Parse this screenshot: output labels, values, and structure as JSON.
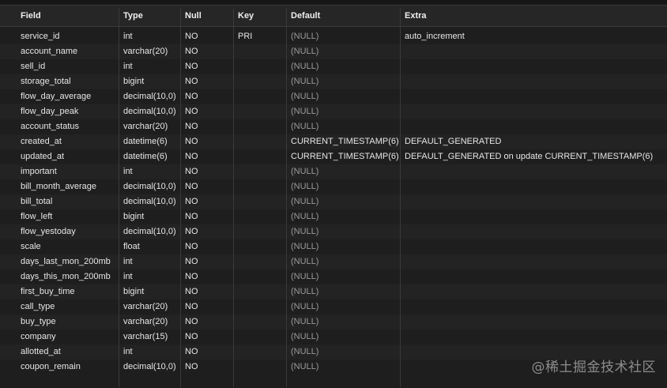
{
  "columns": [
    "Field",
    "Type",
    "Null",
    "Key",
    "Default",
    "Extra"
  ],
  "rows": [
    [
      "service_id",
      "int",
      "NO",
      "PRI",
      "(NULL)",
      "auto_increment"
    ],
    [
      "account_name",
      "varchar(20)",
      "NO",
      "",
      "(NULL)",
      ""
    ],
    [
      "sell_id",
      "int",
      "NO",
      "",
      "(NULL)",
      ""
    ],
    [
      "storage_total",
      "bigint",
      "NO",
      "",
      "(NULL)",
      ""
    ],
    [
      "flow_day_average",
      "decimal(10,0)",
      "NO",
      "",
      "(NULL)",
      ""
    ],
    [
      "flow_day_peak",
      "decimal(10,0)",
      "NO",
      "",
      "(NULL)",
      ""
    ],
    [
      "account_status",
      "varchar(20)",
      "NO",
      "",
      "(NULL)",
      ""
    ],
    [
      "created_at",
      "datetime(6)",
      "NO",
      "",
      "CURRENT_TIMESTAMP(6)",
      "DEFAULT_GENERATED"
    ],
    [
      "updated_at",
      "datetime(6)",
      "NO",
      "",
      "CURRENT_TIMESTAMP(6)",
      "DEFAULT_GENERATED on update CURRENT_TIMESTAMP(6)"
    ],
    [
      "important",
      "int",
      "NO",
      "",
      "(NULL)",
      ""
    ],
    [
      "bill_month_average",
      "decimal(10,0)",
      "NO",
      "",
      "(NULL)",
      ""
    ],
    [
      "bill_total",
      "decimal(10,0)",
      "NO",
      "",
      "(NULL)",
      ""
    ],
    [
      "flow_left",
      "bigint",
      "NO",
      "",
      "(NULL)",
      ""
    ],
    [
      "flow_yestoday",
      "decimal(10,0)",
      "NO",
      "",
      "(NULL)",
      ""
    ],
    [
      "scale",
      "float",
      "NO",
      "",
      "(NULL)",
      ""
    ],
    [
      "days_last_mon_200mb",
      "int",
      "NO",
      "",
      "(NULL)",
      ""
    ],
    [
      "days_this_mon_200mb",
      "int",
      "NO",
      "",
      "(NULL)",
      ""
    ],
    [
      "first_buy_time",
      "bigint",
      "NO",
      "",
      "(NULL)",
      ""
    ],
    [
      "call_type",
      "varchar(20)",
      "NO",
      "",
      "(NULL)",
      ""
    ],
    [
      "buy_type",
      "varchar(20)",
      "NO",
      "",
      "(NULL)",
      ""
    ],
    [
      "company",
      "varchar(15)",
      "NO",
      "",
      "(NULL)",
      ""
    ],
    [
      "allotted_at",
      "int",
      "NO",
      "",
      "(NULL)",
      ""
    ],
    [
      "coupon_remain",
      "decimal(10,0)",
      "NO",
      "",
      "(NULL)",
      ""
    ]
  ],
  "watermark": "@稀土掘金技术社区"
}
